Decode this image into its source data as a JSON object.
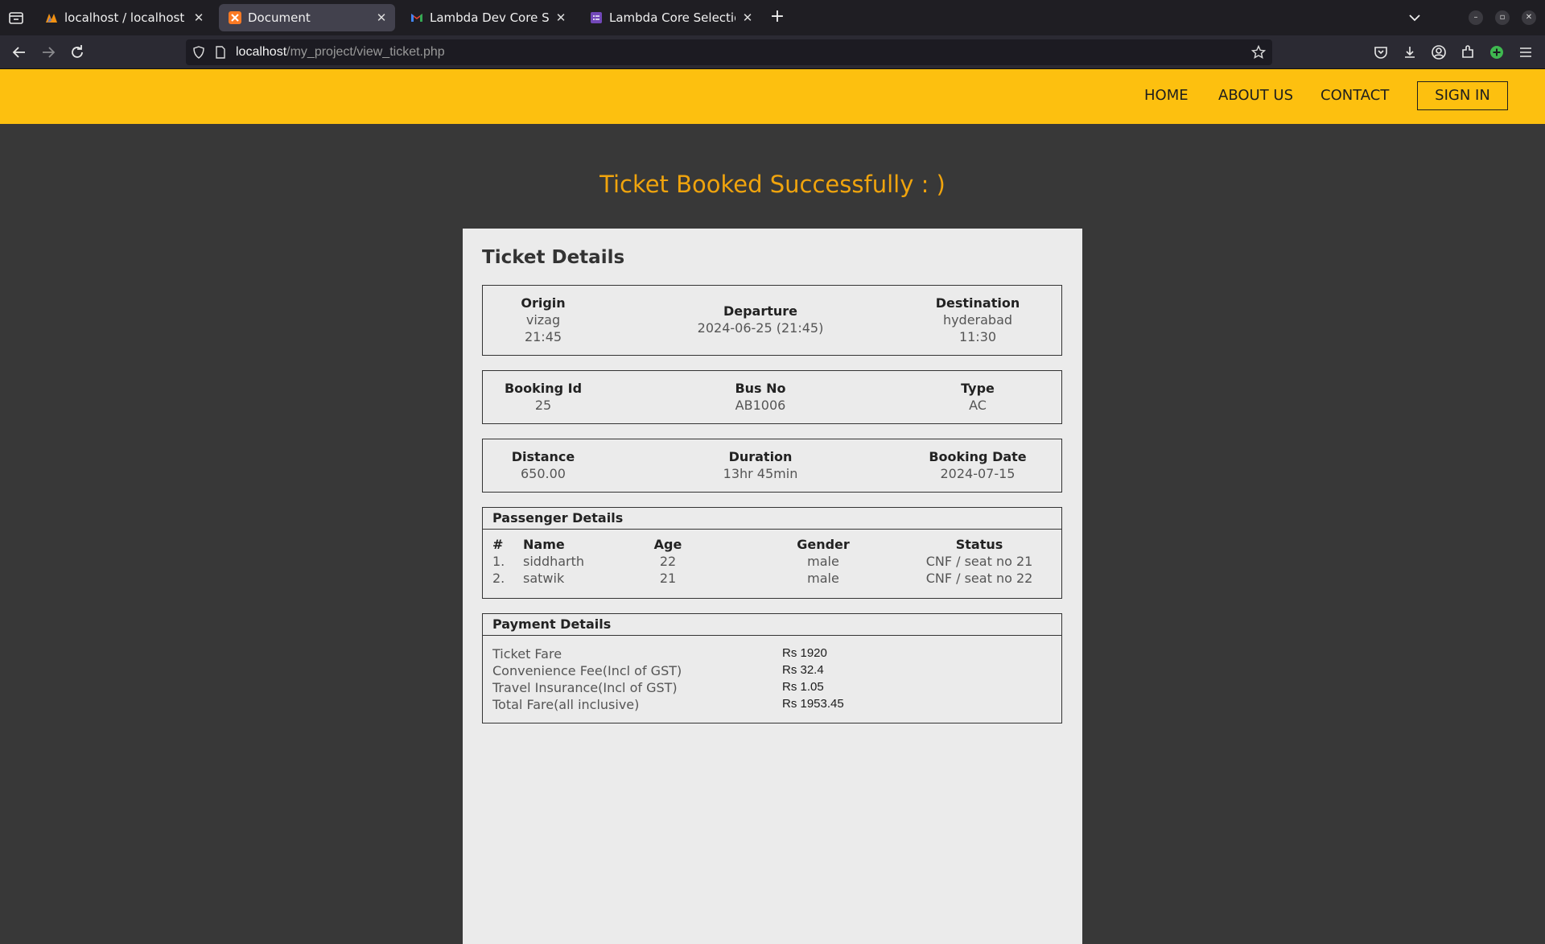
{
  "browser": {
    "tabs": [
      {
        "title": "localhost / localhost / bu",
        "icon": "phpmyadmin-icon"
      },
      {
        "title": "Document",
        "icon": "xampp-icon",
        "active": true
      },
      {
        "title": "Lambda Dev Core Selecti",
        "icon": "gmail-icon"
      },
      {
        "title": "Lambda Core Selection",
        "icon": "form-icon"
      }
    ],
    "url_host": "localhost",
    "url_path": "/my_project/view_ticket.php"
  },
  "site": {
    "nav": [
      "HOME",
      "ABOUT US",
      "CONTACT"
    ],
    "signin": "SIGN IN",
    "brand_color": "#fdc00f"
  },
  "page": {
    "success_message": "Ticket Booked Successfully : )",
    "card_title": "Ticket Details",
    "journey": {
      "origin_label": "Origin",
      "origin_city": "vizag",
      "origin_time": "21:45",
      "departure_label": "Departure",
      "departure_value": "2024-06-25 (21:45)",
      "destination_label": "Destination",
      "destination_city": "hyderabad",
      "destination_time": "11:30"
    },
    "booking": {
      "id_label": "Booking Id",
      "id_value": "25",
      "bus_label": "Bus No",
      "bus_value": "AB1006",
      "type_label": "Type",
      "type_value": "AC"
    },
    "trip": {
      "distance_label": "Distance",
      "distance_value": "650.00",
      "duration_label": "Duration",
      "duration_value": "13hr 45min",
      "date_label": "Booking Date",
      "date_value": "2024-07-15"
    },
    "passengers": {
      "title": "Passenger Details",
      "headers": [
        "#",
        "Name",
        "Age",
        "Gender",
        "Status"
      ],
      "rows": [
        [
          "1.",
          "siddharth",
          "22",
          "male",
          "CNF / seat no 21"
        ],
        [
          "2.",
          "satwik",
          "21",
          "male",
          "CNF / seat no 22"
        ]
      ]
    },
    "payment": {
      "title": "Payment Details",
      "rows": [
        {
          "label": "Ticket Fare",
          "value": "Rs 1920"
        },
        {
          "label": "Convenience Fee(Incl of GST)",
          "value": "Rs 32.4"
        },
        {
          "label": "Travel Insurance(Incl of GST)",
          "value": "Rs 1.05"
        },
        {
          "label": "Total Fare(all inclusive)",
          "value": "Rs 1953.45"
        }
      ]
    }
  }
}
